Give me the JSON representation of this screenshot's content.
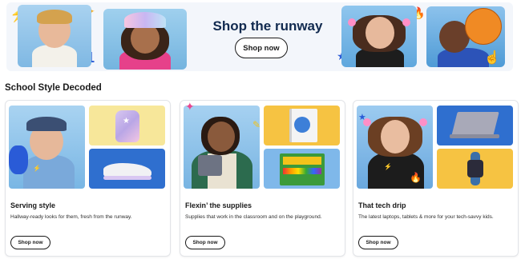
{
  "hero": {
    "title": "Shop the runway",
    "button_label": "Shop now"
  },
  "section": {
    "title": "School Style Decoded"
  },
  "cards": [
    {
      "title": "Serving style",
      "description": "Hallway-ready looks for them, fresh from the runway.",
      "button_label": "Shop now"
    },
    {
      "title": "Flexin’ the supplies",
      "description": "Supplies that work in the classroom and on the playground.",
      "button_label": "Shop now"
    },
    {
      "title": "That tech drip",
      "description": "The latest laptops, tablets & more for your tech-savvy kids.",
      "button_label": "Shop now"
    }
  ],
  "colors": {
    "hero_bg": "#f3f6fb",
    "title_navy": "#112a4f",
    "tile_yellow": "#f6c342",
    "tile_blue": "#2f6fcf"
  }
}
